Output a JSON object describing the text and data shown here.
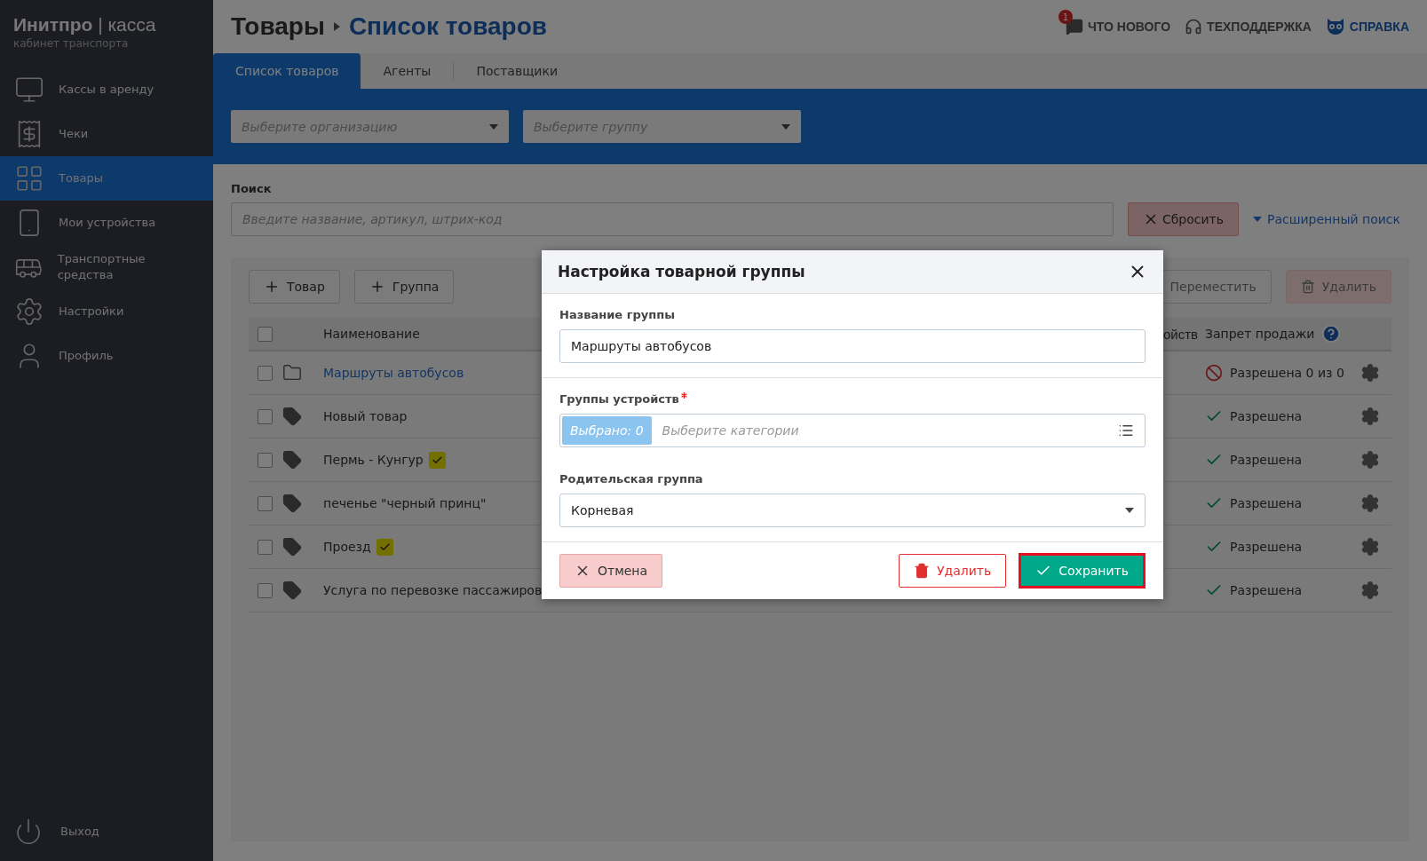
{
  "brand": {
    "name": "Инитпро",
    "separator": "|",
    "product": "касса",
    "subtitle": "кабинет транспорта"
  },
  "sidebar": {
    "items": [
      {
        "label": "Кассы в аренду",
        "selected": false
      },
      {
        "label": "Чеки",
        "selected": false
      },
      {
        "label": "Товары",
        "selected": true
      },
      {
        "label": "Мои устройства",
        "selected": false
      },
      {
        "label": "Транспортные средства",
        "selected": false
      },
      {
        "label": "Настройки",
        "selected": false
      },
      {
        "label": "Профиль",
        "selected": false
      }
    ],
    "logout": "Выход"
  },
  "header": {
    "breadcrumb": [
      "Товары",
      "Список товаров"
    ],
    "links": [
      {
        "label": "ЧТО НОВОГО",
        "badge": "1"
      },
      {
        "label": "ТЕХПОДДЕРЖКА"
      },
      {
        "label": "СПРАВКА"
      }
    ]
  },
  "tabs": [
    {
      "label": "Список товаров",
      "selected": true
    },
    {
      "label": "Агенты",
      "selected": false
    },
    {
      "label": "Поставщики",
      "selected": false
    }
  ],
  "filters": [
    {
      "placeholder": "Выберите организацию"
    },
    {
      "placeholder": "Выберите группу"
    }
  ],
  "search": {
    "label": "Поиск",
    "placeholder": "Введите название, артикул, штрих-код",
    "reset": "Сбросить",
    "advanced": "Расширенный поиск"
  },
  "toolbar": {
    "add": [
      "Товар",
      "Группа"
    ],
    "move": "Переместить",
    "delete": "Удалить"
  },
  "table": {
    "all_checked": false,
    "columns": [
      "Наименование",
      "ойств",
      "Запрет продажи"
    ],
    "rows": [
      {
        "kind": "group",
        "name": "Маршруты автобусов",
        "badge": false,
        "status": {
          "kind": "forbidden",
          "text": "Разрешена 0 из 0"
        },
        "checked": false
      },
      {
        "kind": "item",
        "name": "Новый товар",
        "badge": false,
        "status": {
          "kind": "allowed",
          "text": "Разрешена"
        },
        "checked": false
      },
      {
        "kind": "item",
        "name": "Пермь - Кунгур",
        "badge": true,
        "status": {
          "kind": "allowed",
          "text": "Разрешена"
        },
        "checked": false
      },
      {
        "kind": "item",
        "name": "печенье \"черный принц\"",
        "badge": false,
        "status": {
          "kind": "allowed",
          "text": "Разрешена"
        },
        "checked": false
      },
      {
        "kind": "item",
        "name": "Проезд",
        "badge": true,
        "status": {
          "kind": "allowed",
          "text": "Разрешена"
        },
        "checked": false
      },
      {
        "kind": "item",
        "name": "Услуга по перевозке пассажиров",
        "badge": false,
        "status": {
          "kind": "allowed",
          "text": "Разрешена"
        },
        "checked": false
      }
    ]
  },
  "modal": {
    "title": "Настройка товарной группы",
    "fields": [
      {
        "kind": "text",
        "label": "Название группы",
        "value": "Маршруты автобусов",
        "required": false
      },
      {
        "kind": "multiselect",
        "label": "Группы устройств",
        "required": true,
        "chip": "Выбрано: 0",
        "placeholder": "Выберите категории"
      },
      {
        "kind": "select",
        "label": "Родительская группа",
        "value": "Корневая",
        "required": false
      }
    ],
    "buttons": {
      "cancel": "Отмена",
      "delete": "Удалить",
      "save": "Сохранить"
    }
  }
}
